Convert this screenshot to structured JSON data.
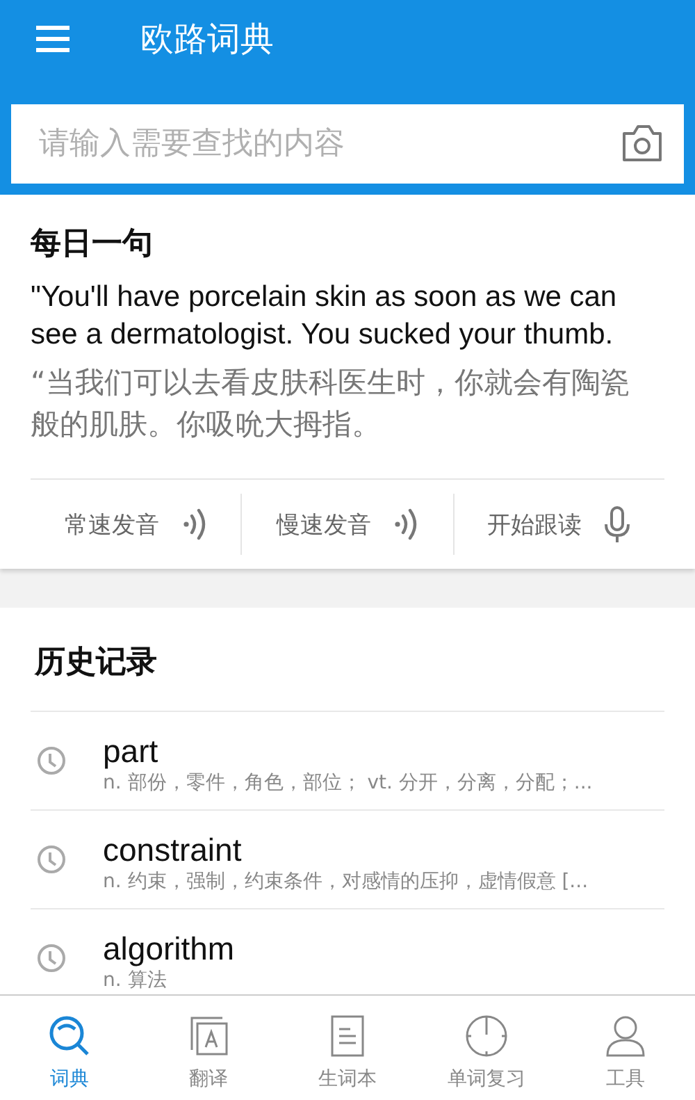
{
  "app_bar": {
    "title": "欧路词典"
  },
  "search": {
    "placeholder": "请输入需要查找的内容"
  },
  "daily": {
    "heading": "每日一句",
    "english": "\"You'll have porcelain skin as soon as we can see a dermatologist. You sucked your thumb.",
    "chinese": "“当我们可以去看皮肤科医生时，你就会有陶瓷般的肌肤。你吸吮大拇指。",
    "actions": [
      {
        "label": "常速发音",
        "kind": "speaker"
      },
      {
        "label": "慢速发音",
        "kind": "speaker"
      },
      {
        "label": "开始跟读",
        "kind": "mic"
      }
    ]
  },
  "history": {
    "heading": "历史记录",
    "items": [
      {
        "word": "part",
        "definition": "n. 部份，零件，角色，部位； vt. 分开，分离，分配；..."
      },
      {
        "word": "constraint",
        "definition": "n. 约束，强制，约束条件，对感情的压抑，虚情假意 [..."
      },
      {
        "word": "algorithm",
        "definition": "n. 算法"
      }
    ]
  },
  "tabs": [
    {
      "label": "词典",
      "kind": "search",
      "selected": true
    },
    {
      "label": "翻译",
      "kind": "translate",
      "selected": false
    },
    {
      "label": "生词本",
      "kind": "notebook",
      "selected": false
    },
    {
      "label": "单词复习",
      "kind": "clock",
      "selected": false
    },
    {
      "label": "工具",
      "kind": "person",
      "selected": false
    }
  ]
}
